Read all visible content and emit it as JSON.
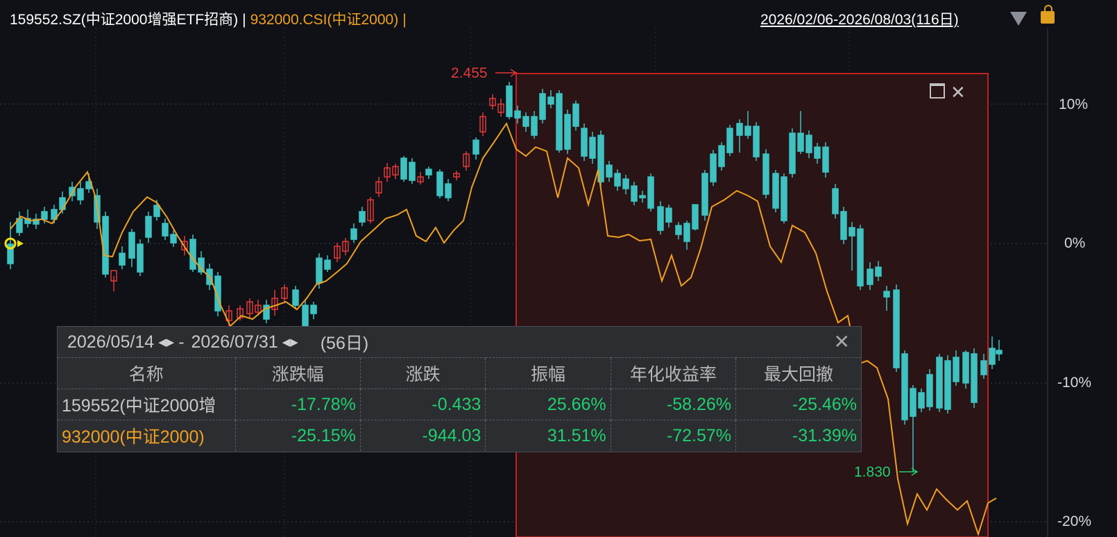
{
  "header": {
    "security": "159552.SZ(中证2000增强ETF招商)",
    "separator": "|",
    "benchmark": "932000.CSI(中证2000)",
    "trailing_sep": "|",
    "date_range": "2026/02/06-2026/08/03(116日)"
  },
  "chart": {
    "y_labels": [
      "10%",
      "0%",
      "-10%",
      "-20%"
    ],
    "high_marker": "2.455",
    "low_marker": "1.830",
    "colors": {
      "up": "#e63838",
      "down": "#3ec2c2",
      "benchmark_line": "#f0a020",
      "selection": "#cc2222"
    }
  },
  "stats_panel": {
    "start_date": "2026/05/14",
    "end_date": "2026/07/31",
    "dash": "-",
    "days": "(56日)",
    "columns": [
      "名称",
      "涨跌幅",
      "涨跌",
      "振幅",
      "年化收益率",
      "最大回撤"
    ],
    "rows": [
      {
        "name": "159552(中证2000增",
        "change_pct": "-17.78%",
        "change": "-0.433",
        "amplitude": "25.66%",
        "annualized": "-58.26%",
        "max_drawdown": "-25.46%"
      },
      {
        "name": "932000(中证2000)",
        "change_pct": "-25.15%",
        "change": "-944.03",
        "amplitude": "31.51%",
        "annualized": "-72.57%",
        "max_drawdown": "-31.39%"
      }
    ]
  }
}
